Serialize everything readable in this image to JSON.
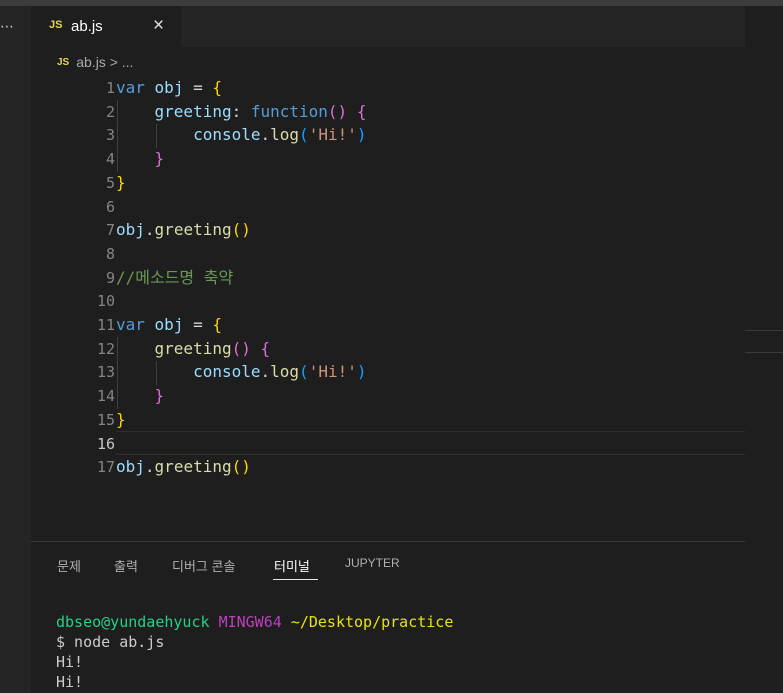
{
  "colors": {
    "background": "#1e1e1e",
    "tab_bar": "#252526",
    "js_badge": "#e8d44d",
    "keyword": "#569cd6",
    "variable": "#9cdcfe",
    "function": "#dcdcaa",
    "string": "#ce9178",
    "comment": "#6a9955",
    "bracket_1": "#ffd700",
    "bracket_2": "#da70d6",
    "bracket_3": "#179fff",
    "terminal_user": "#23d18b",
    "terminal_host": "#bc3fbc",
    "terminal_path": "#e5e510"
  },
  "tab": {
    "icon": "JS",
    "filename": "ab.js",
    "close": "×"
  },
  "breadcrumb": {
    "icon": "JS",
    "file": "ab.js",
    "separator": ">",
    "more": "..."
  },
  "editor": {
    "active_line": 16,
    "lines": [
      {
        "num": "1",
        "tokens": [
          [
            "kw",
            "var"
          ],
          [
            "pl",
            " "
          ],
          [
            "id",
            "obj"
          ],
          [
            "pl",
            " = "
          ],
          [
            "b1",
            "{"
          ]
        ]
      },
      {
        "num": "2",
        "tokens": [
          [
            "pl",
            "    "
          ],
          [
            "id",
            "greeting"
          ],
          [
            "pl",
            ": "
          ],
          [
            "kw",
            "function"
          ],
          [
            "b2",
            "()"
          ],
          [
            "pl",
            " "
          ],
          [
            "b2",
            "{"
          ]
        ]
      },
      {
        "num": "3",
        "tokens": [
          [
            "pl",
            "        "
          ],
          [
            "id",
            "console"
          ],
          [
            "pl",
            "."
          ],
          [
            "fn",
            "log"
          ],
          [
            "b3",
            "("
          ],
          [
            "str",
            "'Hi!'"
          ],
          [
            "b3",
            ")"
          ]
        ]
      },
      {
        "num": "4",
        "tokens": [
          [
            "pl",
            "    "
          ],
          [
            "b2",
            "}"
          ]
        ]
      },
      {
        "num": "5",
        "tokens": [
          [
            "b1",
            "}"
          ]
        ]
      },
      {
        "num": "6",
        "tokens": []
      },
      {
        "num": "7",
        "tokens": [
          [
            "id",
            "obj"
          ],
          [
            "pl",
            "."
          ],
          [
            "fn",
            "greeting"
          ],
          [
            "b1",
            "()"
          ]
        ]
      },
      {
        "num": "8",
        "tokens": []
      },
      {
        "num": "9",
        "tokens": [
          [
            "cm",
            "//메소드명 축약"
          ]
        ]
      },
      {
        "num": "10",
        "tokens": []
      },
      {
        "num": "11",
        "tokens": [
          [
            "kw",
            "var"
          ],
          [
            "pl",
            " "
          ],
          [
            "id",
            "obj"
          ],
          [
            "pl",
            " = "
          ],
          [
            "b1",
            "{"
          ]
        ]
      },
      {
        "num": "12",
        "tokens": [
          [
            "pl",
            "    "
          ],
          [
            "fn",
            "greeting"
          ],
          [
            "b2",
            "()"
          ],
          [
            "pl",
            " "
          ],
          [
            "b2",
            "{"
          ]
        ]
      },
      {
        "num": "13",
        "tokens": [
          [
            "pl",
            "        "
          ],
          [
            "id",
            "console"
          ],
          [
            "pl",
            "."
          ],
          [
            "fn",
            "log"
          ],
          [
            "b3",
            "("
          ],
          [
            "str",
            "'Hi!'"
          ],
          [
            "b3",
            ")"
          ]
        ]
      },
      {
        "num": "14",
        "tokens": [
          [
            "pl",
            "    "
          ],
          [
            "b2",
            "}"
          ]
        ]
      },
      {
        "num": "15",
        "tokens": [
          [
            "b1",
            "}"
          ]
        ]
      },
      {
        "num": "16",
        "tokens": []
      },
      {
        "num": "17",
        "tokens": [
          [
            "id",
            "obj"
          ],
          [
            "pl",
            "."
          ],
          [
            "fn",
            "greeting"
          ],
          [
            "b1",
            "()"
          ]
        ]
      }
    ]
  },
  "panel": {
    "tabs": [
      {
        "label": "문제",
        "active": false
      },
      {
        "label": "출력",
        "active": false
      },
      {
        "label": "디버그 콘솔",
        "active": false
      },
      {
        "label": "터미널",
        "active": true
      },
      {
        "label": "JUPYTER",
        "active": false
      }
    ]
  },
  "terminal": {
    "user": "dbseo@yundaehyuck",
    "host": "MINGW64",
    "path": "~/Desktop/practice",
    "command": "$ node ab.js",
    "output": [
      "Hi!",
      "Hi!"
    ]
  }
}
